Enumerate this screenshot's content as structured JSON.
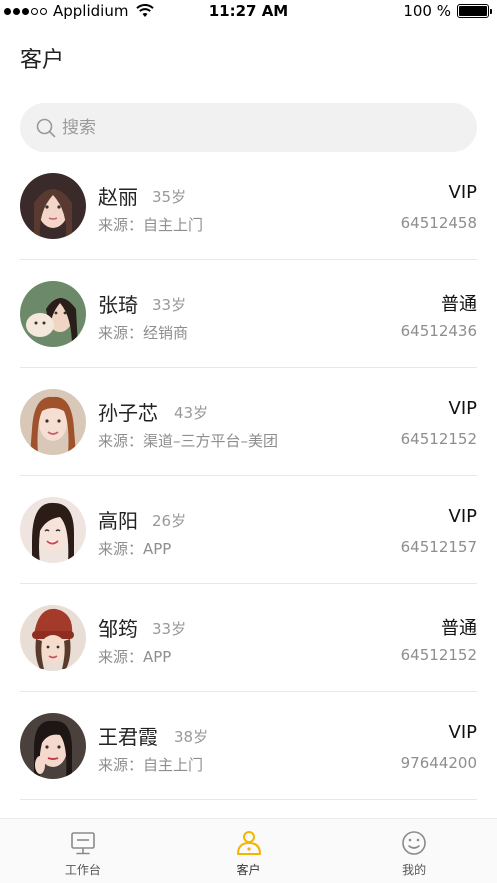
{
  "status_bar": {
    "carrier": "Applidium",
    "time": "11:27 AM",
    "battery_text": "100 %",
    "battery_level": 1.0
  },
  "page_title": "客户",
  "search": {
    "placeholder": "搜索"
  },
  "customers": [
    {
      "name": "赵丽",
      "age": "35岁",
      "source": "来源：自主上门",
      "tier": "VIP",
      "phone": "64512458"
    },
    {
      "name": "张琦",
      "age": "33岁",
      "source": "来源：经销商",
      "tier": "普通",
      "phone": "64512436"
    },
    {
      "name": "孙子芯",
      "age": "43岁",
      "source": "来源：渠道–三方平台–美团",
      "tier": "VIP",
      "phone": "64512152"
    },
    {
      "name": "高阳",
      "age": "26岁",
      "source": "来源：APP",
      "tier": "VIP",
      "phone": "64512157"
    },
    {
      "name": "邹筠",
      "age": "33岁",
      "source": "来源：APP",
      "tier": "普通",
      "phone": "64512152"
    },
    {
      "name": "王君霞",
      "age": "38岁",
      "source": "来源：自主上门",
      "tier": "VIP",
      "phone": "97644200"
    }
  ],
  "tabbar": {
    "tabs": [
      {
        "label": "工作台",
        "icon": "monitor-icon"
      },
      {
        "label": "客户",
        "icon": "user-icon",
        "active": true
      },
      {
        "label": "我的",
        "icon": "smile-icon"
      }
    ],
    "accent_color": "#F5B400"
  }
}
